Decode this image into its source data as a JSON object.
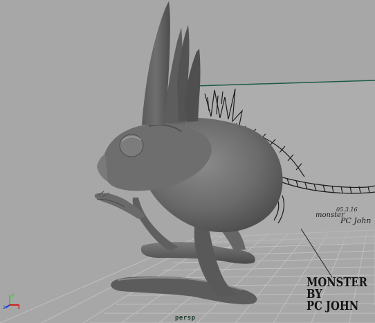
{
  "viewport": {
    "camera_label": "persp",
    "overlay_lines": [
      "MONSTER",
      "BY",
      "PC JOHN"
    ]
  },
  "sketch_text": {
    "date": "05.3.16",
    "signature": "PC John",
    "monster_word": "monster"
  },
  "axis_gizmo": {
    "x_label": "x",
    "y_label": "y",
    "z_label": "z"
  },
  "colors": {
    "background": "#a7a7a7",
    "grid": "#c4c4c4",
    "image_plane_border": "#1e5a4a",
    "model": "#6e6e6e"
  }
}
